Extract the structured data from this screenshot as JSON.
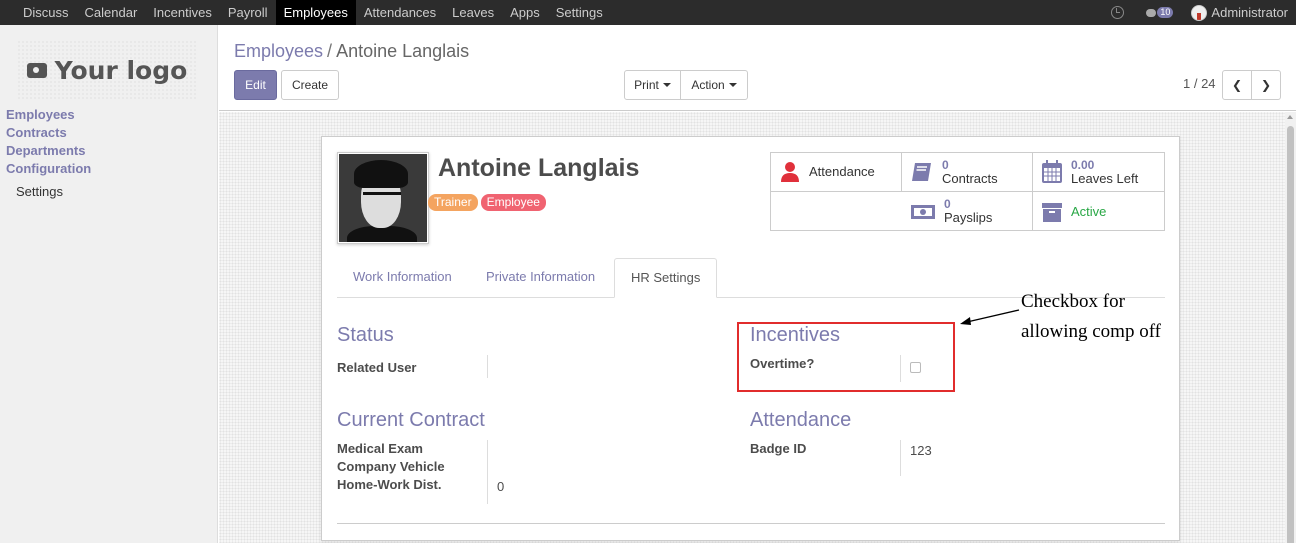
{
  "topbar": {
    "menu": [
      "Discuss",
      "Calendar",
      "Incentives",
      "Payroll",
      "Employees",
      "Attendances",
      "Leaves",
      "Apps",
      "Settings"
    ],
    "active": "Employees",
    "notifications": "10",
    "user": "Administrator"
  },
  "sidebar": {
    "logo": "Your logo",
    "items": [
      "Employees",
      "Contracts",
      "Departments",
      "Configuration"
    ],
    "sub_item": "Settings"
  },
  "control_panel": {
    "breadcrumb_parent": "Employees",
    "breadcrumb_sep": "/",
    "breadcrumb_current": "Antoine Langlais",
    "edit_label": "Edit",
    "create_label": "Create",
    "print_label": "Print",
    "action_label": "Action",
    "pager": "1 / 24"
  },
  "employee": {
    "name": "Antoine Langlais",
    "tags": [
      {
        "label": "Trainer",
        "color": "#f4a460"
      },
      {
        "label": "Employee",
        "color": "#f06371"
      }
    ]
  },
  "stats": {
    "attendance_label": "Attendance",
    "contracts_num": "0",
    "contracts_label": "Contracts",
    "leaves_num": "0.00",
    "leaves_label": "Leaves Left",
    "payslips_num": "0",
    "payslips_label": "Payslips",
    "active_label": "Active"
  },
  "tabs": [
    "Work Information",
    "Private Information",
    "HR Settings"
  ],
  "active_tab": "HR Settings",
  "status": {
    "title": "Status",
    "related_user_label": "Related User",
    "related_user_value": ""
  },
  "incentives": {
    "title": "Incentives",
    "overtime_label": "Overtime?",
    "overtime_checked": false
  },
  "current_contract": {
    "title": "Current Contract",
    "medical_exam_label": "Medical Exam",
    "company_vehicle_label": "Company Vehicle",
    "home_work_label": "Home-Work Dist.",
    "home_work_value": "0"
  },
  "attendance": {
    "title": "Attendance",
    "badge_label": "Badge ID",
    "badge_value": "123"
  },
  "annotation": {
    "line1": "Checkbox for",
    "line2": "allowing comp off"
  },
  "colors": {
    "accent": "#7c7bad",
    "highlight_box": "#e12c2c",
    "active_status": "#28a745"
  }
}
